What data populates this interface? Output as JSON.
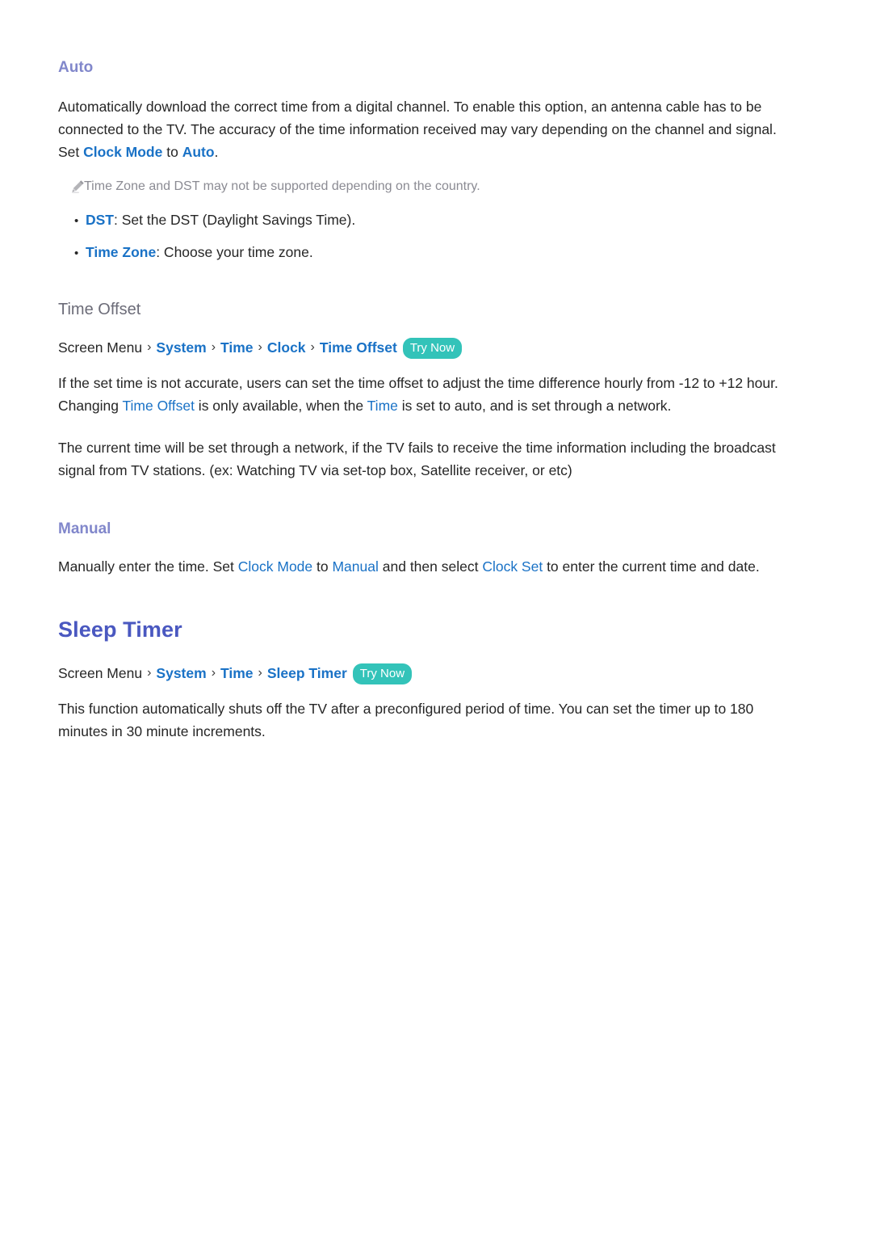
{
  "document": {
    "sections": [
      {
        "id": "auto",
        "heading": "Auto",
        "paragraph": {
          "segments": [
            {
              "text": "Automatically download the correct time from a digital channel. To enable this option, an antenna cable has to be connected to the TV. The accuracy of the time information received may vary depending on the channel and signal. Set ",
              "type": "plain"
            },
            {
              "text": "Clock Mode",
              "type": "link"
            },
            {
              "text": " to ",
              "type": "plain"
            },
            {
              "text": "Auto",
              "type": "link"
            },
            {
              "text": ".",
              "type": "plain"
            }
          ],
          "full_text": "Automatically download the correct time from a digital channel. To enable this option, an antenna cable has to be connected to the TV. The accuracy of the time information received may vary depending on the channel and signal. Set Clock Mode to Auto."
        },
        "note": {
          "icon": "pencil-icon",
          "text": "Time Zone and DST may not be supported depending on the country."
        },
        "bullets": [
          {
            "term": "DST",
            "rest": ": Set the DST (Daylight Savings Time)."
          },
          {
            "term": "Time Zone",
            "rest": ": Choose your time zone."
          }
        ]
      },
      {
        "id": "time-offset",
        "heading": "Time Offset",
        "breadcrumb": {
          "root": "Screen Menu",
          "separator": "›",
          "items": [
            "System",
            "Time",
            "Clock",
            "Time Offset"
          ],
          "badge": "Try Now"
        },
        "paragraph1": {
          "full_text": "If the set time is not accurate, users can set the time offset to adjust the time difference hourly from -12 to +12 hour. Changing Time Offset is only available, when the Time is set to auto, and is set through a network.",
          "pre": "If the set time is not accurate, users can set the time offset to adjust the time difference hourly from -12 to +12 hour. Changing ",
          "link1": "Time Offset",
          "mid": " is only available, when the ",
          "link2": "Time",
          "post": " is set to auto, and is set through a network."
        },
        "paragraph2": "The current time will be set through a network, if the TV fails to receive the time information including the broadcast signal from TV stations. (ex: Watching TV via set-top box, Satellite receiver, or etc)"
      },
      {
        "id": "manual",
        "heading": "Manual",
        "paragraph": {
          "full_text": "Manually enter the time. Set Clock Mode to Manual and then select Clock Set to enter the current time and date.",
          "pre": "Manually enter the time. Set ",
          "link1": "Clock Mode",
          "mid1": " to ",
          "link2": "Manual",
          "mid2": " and then select ",
          "link3": "Clock Set",
          "post": " to enter the current time and date."
        }
      },
      {
        "id": "sleep-timer",
        "heading": "Sleep Timer",
        "breadcrumb": {
          "root": "Screen Menu",
          "separator": "›",
          "items": [
            "System",
            "Time",
            "Sleep Timer"
          ],
          "badge": "Try Now"
        },
        "paragraph": "This function automatically shuts off the TV after a preconfigured period of time. You can set the timer up to 180 minutes in 30 minute increments."
      }
    ]
  },
  "colors": {
    "heading_major": "#4a58c0",
    "heading_minor": "#8187cb",
    "heading_gray": "#6c6c78",
    "link": "#1a72c6",
    "badge_bg": "#33c3b9",
    "badge_text": "#ffffff",
    "body_text": "#262626",
    "note_text": "#8b8b93",
    "page_bg": "#ffffff"
  },
  "symbols": {
    "bullet": "•",
    "chevron": "›"
  }
}
